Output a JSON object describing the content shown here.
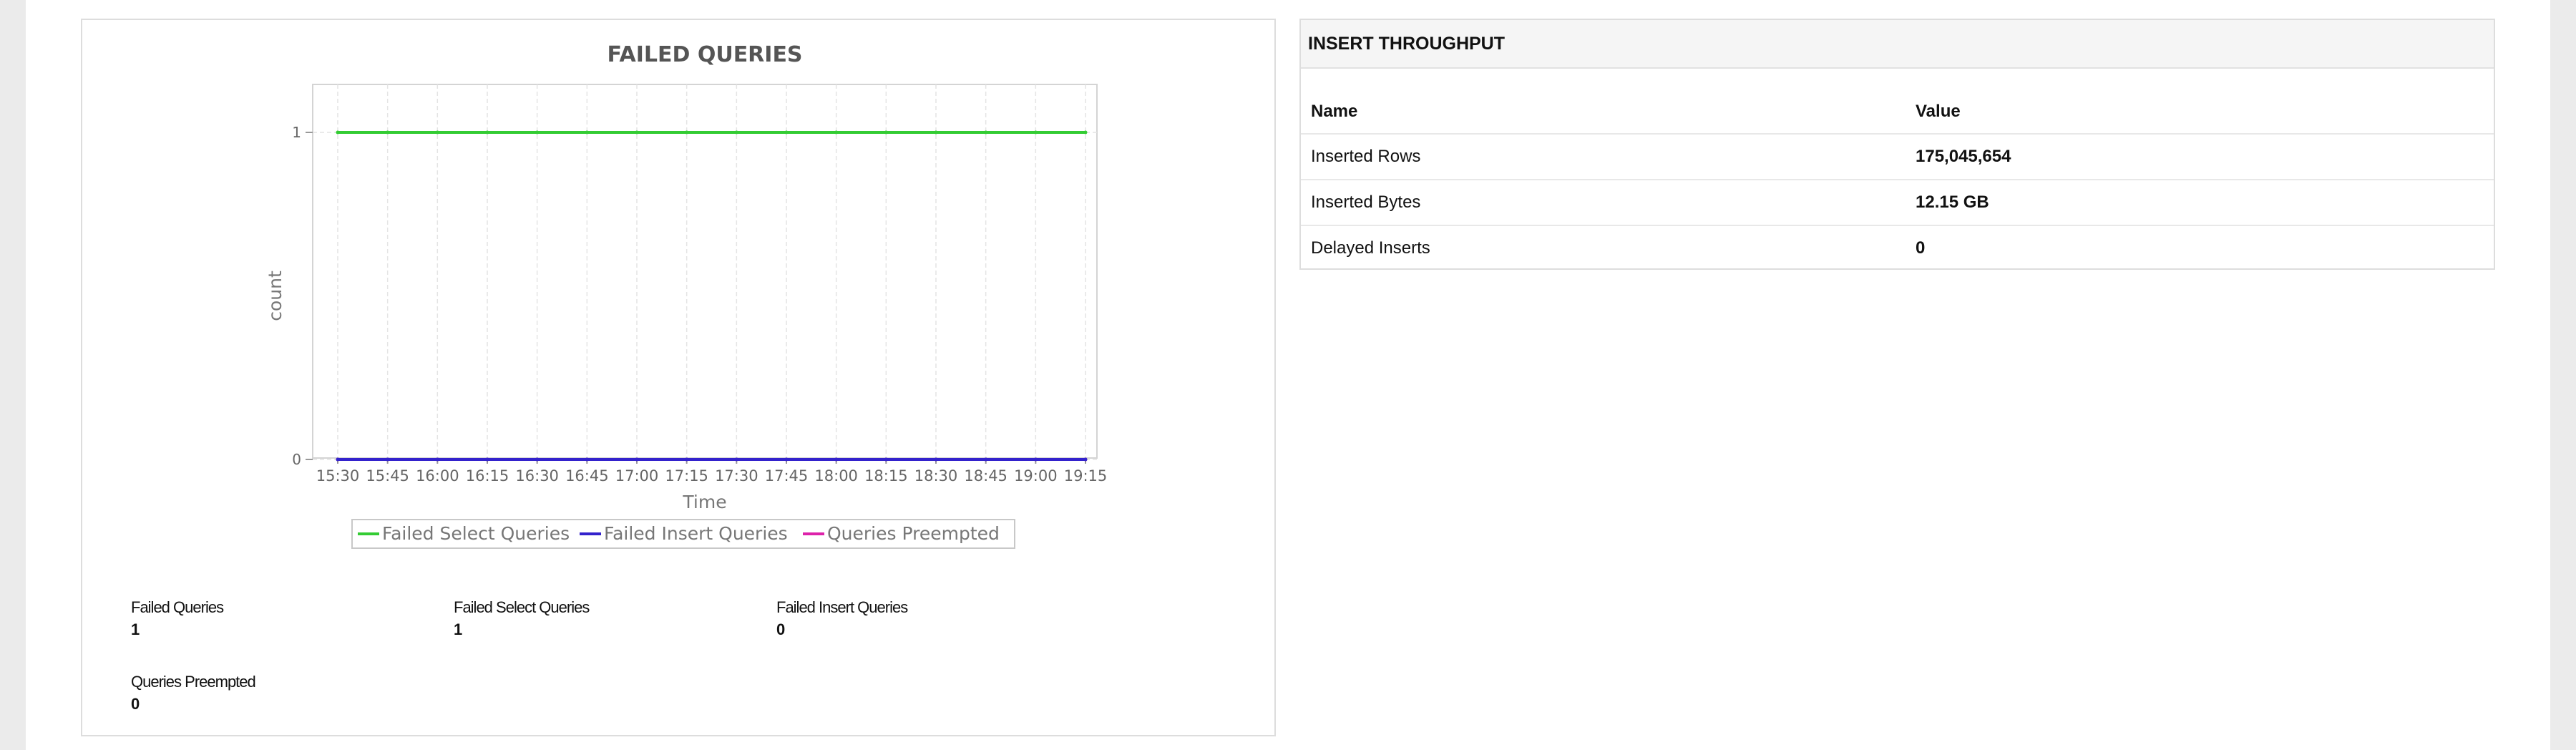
{
  "failed_queries_panel": {
    "stats": [
      {
        "label": "Failed Queries",
        "value": "1"
      },
      {
        "label": "Failed Select Queries",
        "value": "1"
      },
      {
        "label": "Failed Insert Queries",
        "value": "0"
      },
      {
        "label": "Queries Preempted",
        "value": "0"
      }
    ]
  },
  "chart_data": {
    "type": "line",
    "title": "FAILED QUERIES",
    "xlabel": "Time",
    "ylabel": "count",
    "x_ticks": [
      "15:30",
      "15:45",
      "16:00",
      "16:15",
      "16:30",
      "16:45",
      "17:00",
      "17:15",
      "17:30",
      "17:45",
      "18:00",
      "18:15",
      "18:30",
      "18:45",
      "19:00",
      "19:15"
    ],
    "ylim": [
      0,
      1
    ],
    "y_ticks": [
      "0",
      "1"
    ],
    "grid": true,
    "legend_position": "bottom",
    "series": [
      {
        "name": "Failed Select Queries",
        "color": "#33cc33",
        "values": [
          1,
          1,
          1,
          1,
          1,
          1,
          1,
          1,
          1,
          1,
          1,
          1,
          1,
          1,
          1,
          1
        ]
      },
      {
        "name": "Failed Insert Queries",
        "color": "#3322cc",
        "values": [
          0,
          0,
          0,
          0,
          0,
          0,
          0,
          0,
          0,
          0,
          0,
          0,
          0,
          0,
          0,
          0
        ]
      },
      {
        "name": "Queries Preempted",
        "color": "#dd22aa",
        "values": [
          0,
          0,
          0,
          0,
          0,
          0,
          0,
          0,
          0,
          0,
          0,
          0,
          0,
          0,
          0,
          0
        ]
      }
    ]
  },
  "insert_throughput": {
    "title": "INSERT THROUGHPUT",
    "headers": {
      "name": "Name",
      "value": "Value"
    },
    "rows": [
      {
        "name": "Inserted Rows",
        "value": "175,045,654"
      },
      {
        "name": "Inserted Bytes",
        "value": "12.15 GB"
      },
      {
        "name": "Delayed Inserts",
        "value": "0"
      }
    ]
  }
}
